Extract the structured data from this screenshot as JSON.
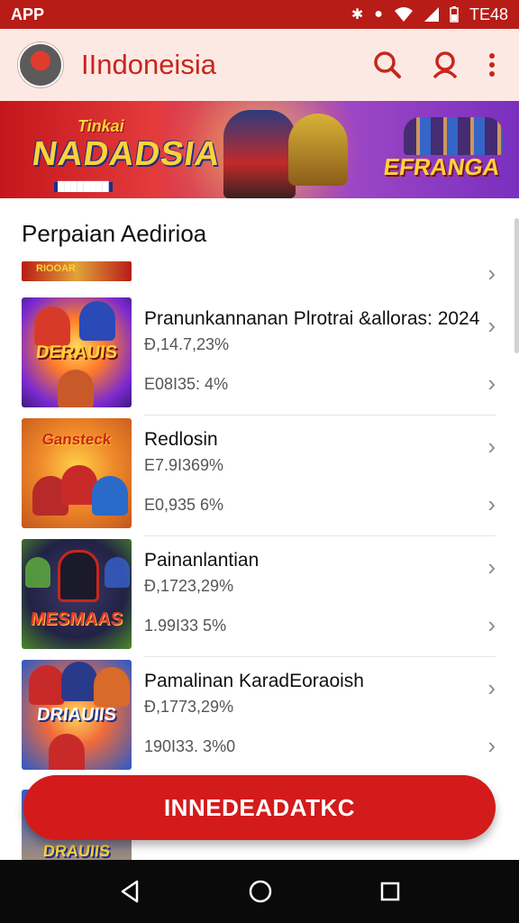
{
  "status_bar": {
    "app_label": "APP",
    "time": "TE48",
    "icons": [
      "bluetooth-icon",
      "alarm-icon",
      "wifi-icon",
      "signal-icon",
      "battery-icon"
    ]
  },
  "app_bar": {
    "title": "IIndoneisia",
    "icons": [
      "search-icon",
      "profile-icon",
      "more-vert-icon"
    ],
    "accent_color": "#c8261c"
  },
  "banner": {
    "left_logo_top": "Tinkai",
    "left_logo": "NADADSIA",
    "right_logo": "EFRANGA"
  },
  "section": {
    "title": "Perpaian Aedirioa"
  },
  "partial_item": {
    "thumb_text": "RIOOAR"
  },
  "games": [
    {
      "thumb_text": "DERAUIS",
      "name": "Pranunkannanan Plrotrai &alloras: 2024",
      "stat1": "Ɖ,14.7,23%",
      "stat2": "E08I35: 4%"
    },
    {
      "thumb_text": "Gansteck",
      "name": "Redlosin",
      "stat1": "E7.9I369%",
      "stat2": "E0,935  6%"
    },
    {
      "thumb_text": "MESMAAS",
      "name": "Painanlantian",
      "stat1": "Ɖ,1723,29%",
      "stat2": "1.99I33  5%"
    },
    {
      "thumb_text": "DRIAUIIS",
      "name": "Pamalinan KaradEoraoish",
      "stat1": "Ɖ,1773,29%",
      "stat2": "190I33. 3%0"
    },
    {
      "thumb_text": "DRAUIIS",
      "name": "",
      "stat1": "",
      "stat2": ""
    }
  ],
  "cta": {
    "label": "INNEDEADATKC",
    "color": "#d31b1b"
  },
  "nav_bar": {
    "icons": [
      "back-icon",
      "home-icon",
      "recents-icon"
    ]
  }
}
